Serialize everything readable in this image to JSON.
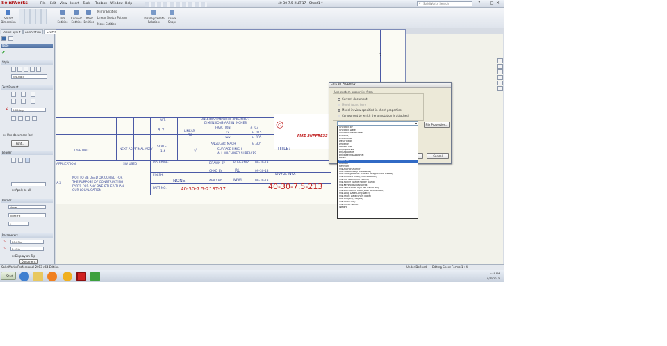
{
  "app": {
    "brand": "SolidWorks",
    "doc_title": "40-30-7.5-2LLT-17 - Sheet1 *",
    "search_placeholder": "SolidWorks Search",
    "menus": [
      "File",
      "Edit",
      "View",
      "Insert",
      "Tools",
      "Toolbox",
      "Window",
      "Help"
    ]
  },
  "ribbon": {
    "smart_dimension": "Smart Dimension",
    "trim": "Trim Entities",
    "convert": "Convert Entities",
    "offset": "Offset Entities",
    "mirror": "Mirror Entities",
    "linear_pattern": "Linear Sketch Pattern",
    "move": "Move Entities",
    "display_delete": "Display/Delete Relations",
    "quick_snaps": "Quick Snaps"
  },
  "tabs": [
    "View Layout",
    "Annotation",
    "Sketch",
    "Evaluate",
    "Office Products"
  ],
  "active_tab": "Sketch",
  "panel": {
    "title": "Note",
    "style_label": "Style",
    "style_value": "<NONE>",
    "text_format_label": "Text Format",
    "angle_value": "0.00deg",
    "use_doc_font": "Use document font",
    "font_button": "Font...",
    "leader_label": "Leader",
    "apply_to_all": "Apply to all",
    "border_label": "Border",
    "border_style": "None",
    "border_size": "Tight Fit",
    "border_count": "5",
    "parameters_label": "Parameters",
    "param_x": "20.03in",
    "param_y": "2.15in",
    "display_on_top": "Display on Top",
    "bottom_btn": "Document"
  },
  "drawing": {
    "zone_number": "2",
    "unless_note": "UNLESS OTHERWISE SPECIFIED:",
    "dims_note": "DIMENSIONS ARE IN INCHES",
    "fraction": "FRACTION",
    "tol1": "±  .03",
    "tol2": "±  .015",
    "tol3": "±  .005",
    "angular": "ANGULAR: MACH",
    "tol_ang": "±  .30°",
    "xx": "xx",
    "xxx": "xxx",
    "wt_label": "WT.",
    "wt_value": "5.7",
    "linear_label": "LINEAR",
    "linear_value": "TO",
    "surface_finish": "SURFACE FINISH:",
    "all_machined": "ALL MACHINED SURFACES",
    "scale_label": "SCALE",
    "scale_value": "1:4",
    "type_unit": "TYPE UNIT",
    "next_assy": "NEXT ASSY",
    "final_assy": "FINAL ASSY",
    "application": "APPLICATION",
    "sw_used": "SW USED",
    "material_label": "MATERIAL:",
    "finish_label": "FINISH:",
    "finish_value": "NONE",
    "not_used": "NOT TO BE USED OR COPIED FOR",
    "purpose": "THE PURPOSE OF CONSTRUCTING",
    "parts": "PARTS FOR ANY ONE OTHER THAN",
    "owner": "OUR LOCALISATION",
    "part_no_label": "PART NO.",
    "part_no_value": "40-30-7.5-213T-17",
    "drawn_by": "DRAWN BY",
    "drawn_value": "RUBERNIZ",
    "drawn_date": "09-30-13",
    "chkd_by": "CHKD BY",
    "chkd_value": "RL",
    "chkd_date": "09-30-13",
    "appd_by": "APPD BY",
    "appd_value": "MWL",
    "appd_date": "09-30-13",
    "title_label": "TITLE:",
    "dwg_no_label": "DWG. NO.",
    "dwg_no_value": "40-30-7.5-213",
    "company_text": "FIRE SUPPRESS",
    "rev_x": "A.X"
  },
  "dialog": {
    "title": "Link to Property",
    "group": "Use custom properties from",
    "opt1": "Current document",
    "opt2": "Model found here",
    "opt3": "Model in view specified in sheet properties",
    "opt4": "Component to which the annotation is attached",
    "file_props": "File Properties...",
    "ok": "OK",
    "cancel": "Cancel"
  },
  "property_list": [
    "Checked by",
    "Checked Date",
    "CheckedDrawnDate",
    "DrawnBy",
    "DrawnDate",
    "Description",
    "Drawnby",
    "DrawnDate",
    "EngApproval",
    "EngAppDate",
    "EngineeringApproval",
    "Finish",
    "Material",
    "Number",
    "Revision",
    "SW-Author(Author)",
    "SW-Comments(Comments)",
    "SW-Configuration Name(Configuration Name)",
    "SW-Created Date(Created Date)",
    "SW-File Name(File Name)",
    "SW-Folder Name(Folder Name)",
    "SW-Keywords(Keywords)",
    "SW-Last Saved By(Last Saved By)",
    "SW-Last Saved Date(Last Saved Date)",
    "SW-Long Date(Long Date)",
    "SW-Short Date(Short Date)",
    "SW-Subject(Subject)",
    "SW-Title(Title)",
    "SW-Sheet Name",
    "Weight"
  ],
  "selected_item": "Material",
  "status": {
    "product": "SolidWorks Professional 2013 x64 Edition",
    "state": "Under Defined",
    "mode": "Editing Sheet Format",
    "scale": "1 : 4"
  },
  "taskbar": {
    "start": "Start",
    "time": "4:49 PM",
    "date": "9/30/2013"
  },
  "colors": {
    "selection": "#316ac5",
    "drawing_lines": "#4b5aa6",
    "brand_red": "#c02020"
  }
}
